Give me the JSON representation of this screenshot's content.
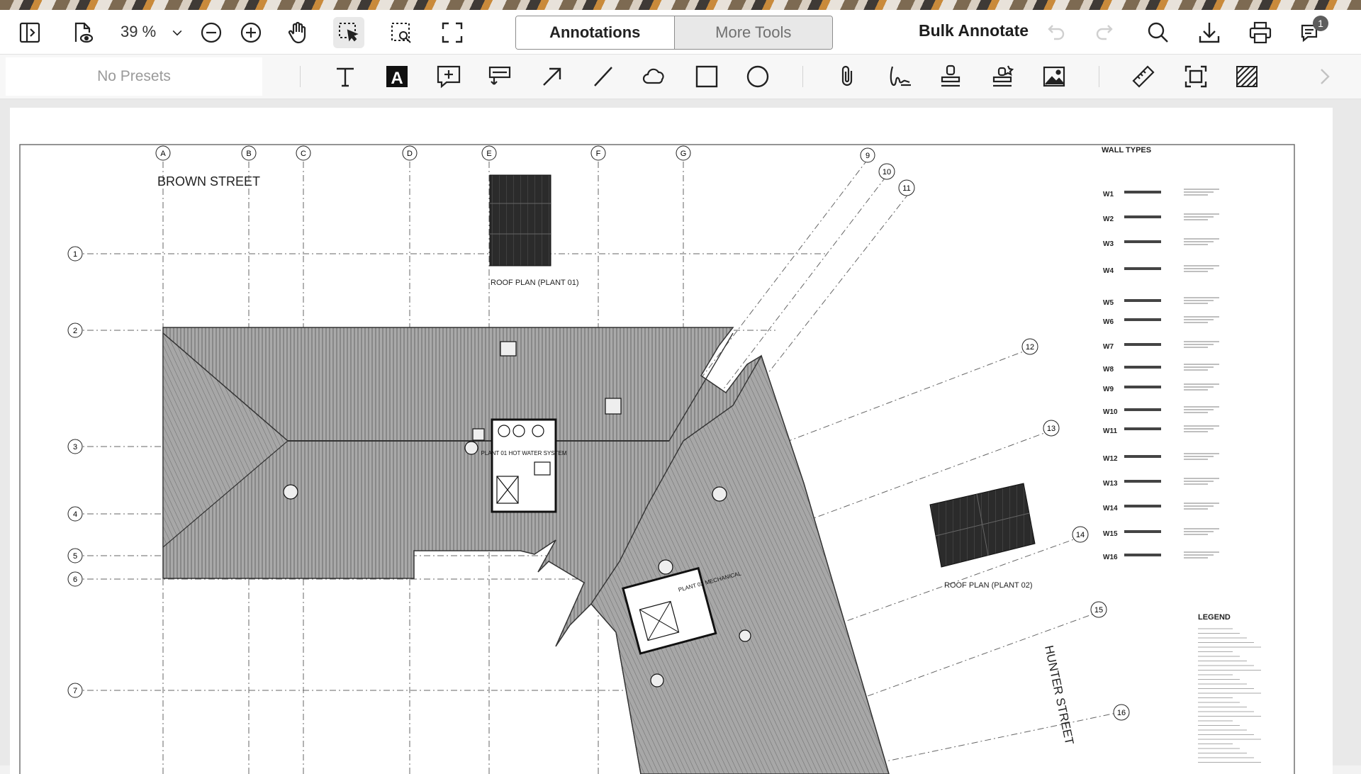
{
  "toolbar": {
    "zoom": "39 %",
    "tabs": [
      {
        "label": "Annotations",
        "active": true
      },
      {
        "label": "More Tools",
        "active": false
      }
    ],
    "bulk_annotate": "Bulk Annotate",
    "notification_count": "1"
  },
  "annotation_toolbar": {
    "presets": "No Presets"
  },
  "drawing": {
    "street_north": "BROWN STREET",
    "street_east": "HUNTER STREET",
    "grid_letters": [
      "A",
      "B",
      "C",
      "D",
      "E",
      "F",
      "G"
    ],
    "grid_numbers_left": [
      "1",
      "2",
      "3",
      "4",
      "5",
      "6",
      "7"
    ],
    "grid_numbers_diag": [
      "9",
      "10",
      "11",
      "12",
      "13",
      "14",
      "15",
      "16"
    ],
    "plant1_label": "ROOF PLAN (PLANT 01)",
    "plant2_label": "ROOF PLAN (PLANT 02)",
    "hot_water_label": "PLANT 01 HOT WATER SYSTEM",
    "plant_mech_label": "PLANT 02 MECHANICAL",
    "wall_types_title": "WALL TYPES",
    "wall_type_ids": [
      "W1",
      "W2",
      "W3",
      "W4",
      "W5",
      "W6",
      "W7",
      "W8",
      "W9",
      "W10",
      "W11",
      "W12",
      "W13",
      "W14",
      "W15",
      "W16"
    ],
    "legend_title": "LEGEND"
  }
}
